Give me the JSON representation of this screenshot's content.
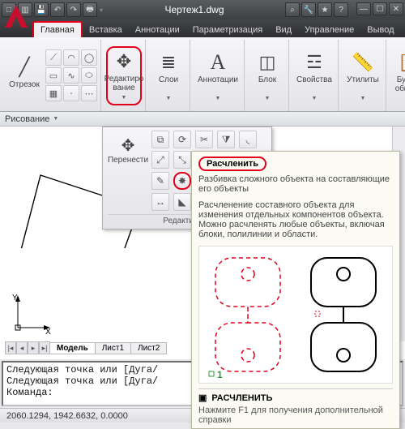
{
  "window": {
    "title": "Чертеж1.dwg",
    "qat_icons": [
      "new-icon",
      "open-icon",
      "save-icon",
      "undo-icon",
      "redo-icon",
      "print-icon"
    ],
    "right_icons": [
      "keyword-icon",
      "wrench-icon",
      "star-icon",
      "help-icon"
    ]
  },
  "tabs": [
    "Главная",
    "Вставка",
    "Аннотации",
    "Параметризация",
    "Вид",
    "Управление",
    "Вывод"
  ],
  "active_tab": "Главная",
  "ribbon": {
    "draw_panel": {
      "label": "Отрезок",
      "panel_title": "Рисование"
    },
    "edit_panel": {
      "label": "Редактиро\nвание"
    },
    "layers": {
      "label": "Слои"
    },
    "annot": {
      "label": "Аннотации"
    },
    "block": {
      "label": "Блок"
    },
    "props": {
      "label": "Свойства"
    },
    "utils": {
      "label": "Утилиты"
    },
    "clip": {
      "label": "Буфер\nобмена"
    }
  },
  "flyout": {
    "move_label": "Перенести",
    "panel_title": "Редактирова"
  },
  "tooltip": {
    "title": "Расчленить",
    "subtitle": "Разбивка сложного объекта на составляющие его объекты",
    "body": "Расчленение составного объекта для изменения отдельных компонентов объекта. Можно расчленять любые объекты, включая блоки, полилинии и области.",
    "marker": "1",
    "cmd": "РАСЧЛЕНИТЬ",
    "help": "Нажмите F1 для получения дополнительной справки"
  },
  "ucs": {
    "x": "X",
    "y": "Y"
  },
  "sheets": {
    "nav": [
      "|◂",
      "◂",
      "▸",
      "▸|"
    ],
    "tabs": [
      "Модель",
      "Лист1",
      "Лист2"
    ],
    "active": 0
  },
  "cmd": {
    "l1": "Следующая точка или [Дуга/",
    "l2": "Следующая точка или [Дуга/",
    "prompt": "Команда:"
  },
  "status": {
    "coords": "2060.1294, 1942.6632, 0.0000"
  }
}
